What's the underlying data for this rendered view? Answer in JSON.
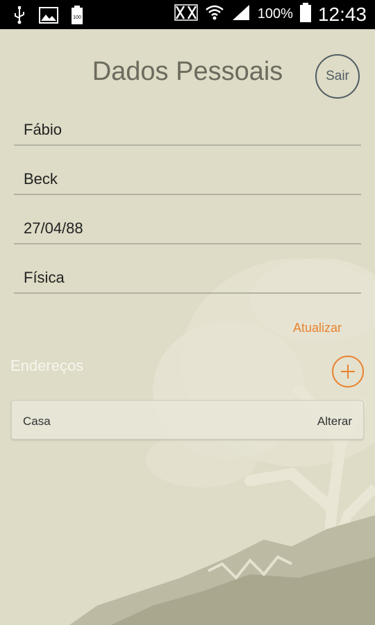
{
  "status_bar": {
    "battery_text": "100%",
    "time": "12:43",
    "icons": [
      "usb-icon",
      "image-icon",
      "battery-small-icon",
      "nfc-icon",
      "wifi-icon",
      "signal-icon",
      "battery-icon"
    ]
  },
  "header": {
    "title": "Dados Pessoais",
    "logout_label": "Sair"
  },
  "form": {
    "first_name": "Fábio",
    "last_name": "Beck",
    "birth_date": "27/04/88",
    "person_type": "Física"
  },
  "update_label": "Atualizar",
  "addresses": {
    "title": "Endereços",
    "items": [
      {
        "name": "Casa",
        "action": "Alterar"
      }
    ]
  },
  "colors": {
    "accent": "#e8832f",
    "background": "#dedbc6",
    "text_dark": "#222222"
  }
}
